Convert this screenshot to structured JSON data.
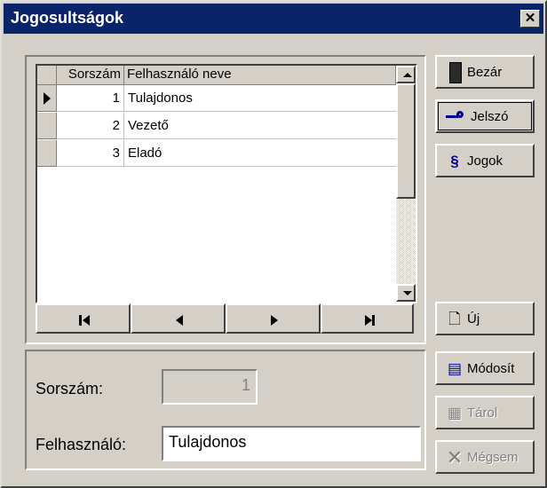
{
  "window": {
    "title": "Jogosultságok",
    "close_glyph": "✕"
  },
  "grid": {
    "columns": [
      "Sorszám",
      "Felhasználó neve"
    ],
    "rows": [
      {
        "num": "1",
        "name": "Tulajdonos",
        "current": true
      },
      {
        "num": "2",
        "name": "Vezető",
        "current": false
      },
      {
        "num": "3",
        "name": "Eladó",
        "current": false
      }
    ]
  },
  "navigator": {
    "icons": [
      "first-record-icon",
      "prior-record-icon",
      "next-record-icon",
      "last-record-icon"
    ]
  },
  "form": {
    "sorszam_label": "Sorszám:",
    "sorszam_value": "1",
    "felhasznalo_label": "Felhasználó:",
    "felhasznalo_value": "Tulajdonos"
  },
  "buttons": {
    "bezar": {
      "label": "Bezár",
      "icon": "door-icon"
    },
    "jelszo": {
      "label": "Jelszó",
      "icon": "key-icon"
    },
    "jogok": {
      "label": "Jogok",
      "icon": "section-sign-icon"
    },
    "uj": {
      "label": "Új",
      "icon": "new-record-icon"
    },
    "modosit": {
      "label": "Módosít",
      "icon": "edit-icon"
    },
    "tarol": {
      "label": "Tárol",
      "icon": "save-icon"
    },
    "megsem": {
      "label": "Mégsem",
      "icon": "cancel-x-icon"
    }
  },
  "colors": {
    "titlebar": "#0a246a",
    "face": "#d4d0c8",
    "accent_icon": "#00008b"
  }
}
